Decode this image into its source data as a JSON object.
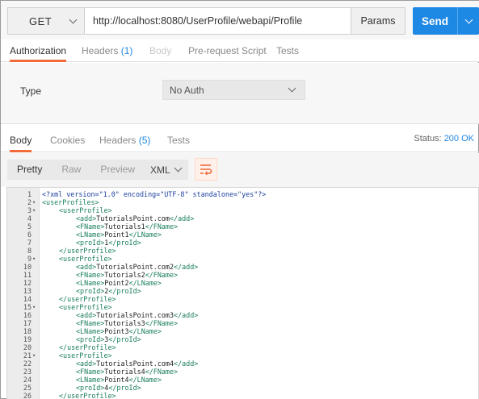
{
  "request": {
    "method": "GET",
    "url": "http://localhost:8080/UserProfile/webapi/Profile",
    "params_label": "Params",
    "send_label": "Send"
  },
  "request_tabs": {
    "authorization": "Authorization",
    "headers": "Headers",
    "headers_count": "(1)",
    "body": "Body",
    "prerequest": "Pre-request Script",
    "tests": "Tests"
  },
  "auth": {
    "type_label": "Type",
    "type_value": "No Auth"
  },
  "response_tabs": {
    "body": "Body",
    "cookies": "Cookies",
    "headers": "Headers",
    "headers_count": "(5)",
    "tests": "Tests",
    "status_label": "Status:",
    "status_value": "200 OK"
  },
  "toolbar": {
    "pretty": "Pretty",
    "raw": "Raw",
    "preview": "Preview",
    "format": "XML"
  },
  "icons": {
    "method_dropdown": "chevron-down-icon",
    "send_dropdown": "chevron-down-icon",
    "wrap": "wrap-lines-icon"
  },
  "colors": {
    "accent": "#f26b3a",
    "send": "#1e88e5",
    "xml_tag": "#1a7f5a"
  },
  "code_lines": [
    {
      "n": "1",
      "fold": "",
      "indent": 0,
      "text": "<?xml version=\"1.0\" encoding=\"UTF-8\" standalone=\"yes\"?>",
      "kind": "pi"
    },
    {
      "n": "2",
      "fold": "▾",
      "indent": 0,
      "text": "<userProfiles>",
      "kind": "tag"
    },
    {
      "n": "3",
      "fold": "▾",
      "indent": 1,
      "text": "<userProfile>",
      "kind": "tag"
    },
    {
      "n": "4",
      "fold": "",
      "indent": 2,
      "text": "<add>TutorialsPoint.com</add>",
      "kind": "elem"
    },
    {
      "n": "5",
      "fold": "",
      "indent": 2,
      "text": "<FName>Tutorials1</FName>",
      "kind": "elem"
    },
    {
      "n": "6",
      "fold": "",
      "indent": 2,
      "text": "<LName>Point1</LName>",
      "kind": "elem"
    },
    {
      "n": "7",
      "fold": "",
      "indent": 2,
      "text": "<proId>1</proId>",
      "kind": "elem"
    },
    {
      "n": "8",
      "fold": "",
      "indent": 1,
      "text": "</userProfile>",
      "kind": "tag"
    },
    {
      "n": "9",
      "fold": "▾",
      "indent": 1,
      "text": "<userProfile>",
      "kind": "tag"
    },
    {
      "n": "10",
      "fold": "",
      "indent": 2,
      "text": "<add>TutorialsPoint.com2</add>",
      "kind": "elem"
    },
    {
      "n": "11",
      "fold": "",
      "indent": 2,
      "text": "<FName>Tutorials2</FName>",
      "kind": "elem"
    },
    {
      "n": "12",
      "fold": "",
      "indent": 2,
      "text": "<LName>Point2</LName>",
      "kind": "elem"
    },
    {
      "n": "13",
      "fold": "",
      "indent": 2,
      "text": "<proId>2</proId>",
      "kind": "elem"
    },
    {
      "n": "14",
      "fold": "",
      "indent": 1,
      "text": "</userProfile>",
      "kind": "tag"
    },
    {
      "n": "15",
      "fold": "▾",
      "indent": 1,
      "text": "<userProfile>",
      "kind": "tag"
    },
    {
      "n": "16",
      "fold": "",
      "indent": 2,
      "text": "<add>TutorialsPoint.com3</add>",
      "kind": "elem"
    },
    {
      "n": "17",
      "fold": "",
      "indent": 2,
      "text": "<FName>Tutorials3</FName>",
      "kind": "elem"
    },
    {
      "n": "18",
      "fold": "",
      "indent": 2,
      "text": "<LName>Point3</LName>",
      "kind": "elem"
    },
    {
      "n": "19",
      "fold": "",
      "indent": 2,
      "text": "<proId>3</proId>",
      "kind": "elem"
    },
    {
      "n": "20",
      "fold": "",
      "indent": 1,
      "text": "</userProfile>",
      "kind": "tag"
    },
    {
      "n": "21",
      "fold": "▾",
      "indent": 1,
      "text": "<userProfile>",
      "kind": "tag"
    },
    {
      "n": "22",
      "fold": "",
      "indent": 2,
      "text": "<add>TutorialsPoint.com4</add>",
      "kind": "elem"
    },
    {
      "n": "23",
      "fold": "",
      "indent": 2,
      "text": "<FName>Tutorials4</FName>",
      "kind": "elem"
    },
    {
      "n": "24",
      "fold": "",
      "indent": 2,
      "text": "<LName>Point4</LName>",
      "kind": "elem"
    },
    {
      "n": "25",
      "fold": "",
      "indent": 2,
      "text": "<proId>4</proId>",
      "kind": "elem"
    },
    {
      "n": "26",
      "fold": "",
      "indent": 1,
      "text": "</userProfile>",
      "kind": "tag"
    }
  ]
}
